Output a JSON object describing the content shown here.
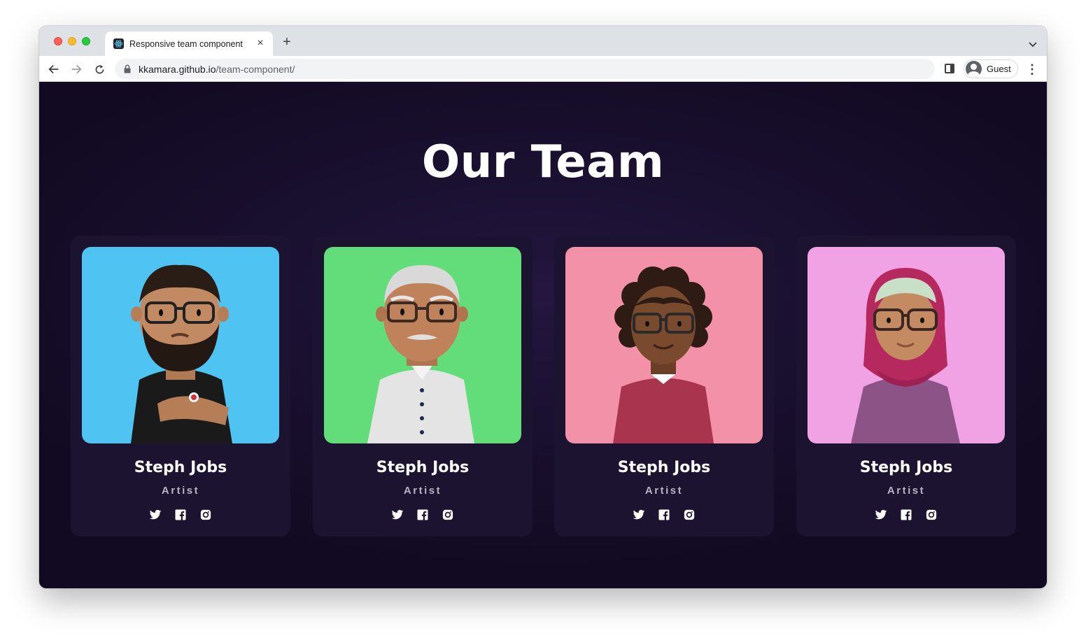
{
  "browser": {
    "tab_title": "Responsive team component",
    "url_host": "kkamara.github.io",
    "url_path": "/team-component/",
    "profile_label": "Guest"
  },
  "page": {
    "title": "Our Team"
  },
  "team": [
    {
      "name": "Steph Jobs",
      "role": "Artist",
      "avatar": "bearded-man-avatar",
      "bg_color": "#4fc3f2"
    },
    {
      "name": "Steph Jobs",
      "role": "Artist",
      "avatar": "older-man-avatar",
      "bg_color": "#63dd7a"
    },
    {
      "name": "Steph Jobs",
      "role": "Artist",
      "avatar": "curly-hair-woman-avatar",
      "bg_color": "#f291a7"
    },
    {
      "name": "Steph Jobs",
      "role": "Artist",
      "avatar": "hijab-woman-avatar",
      "bg_color": "#f0a2e4"
    }
  ],
  "social_icons": [
    "twitter-icon",
    "facebook-icon",
    "instagram-icon"
  ]
}
